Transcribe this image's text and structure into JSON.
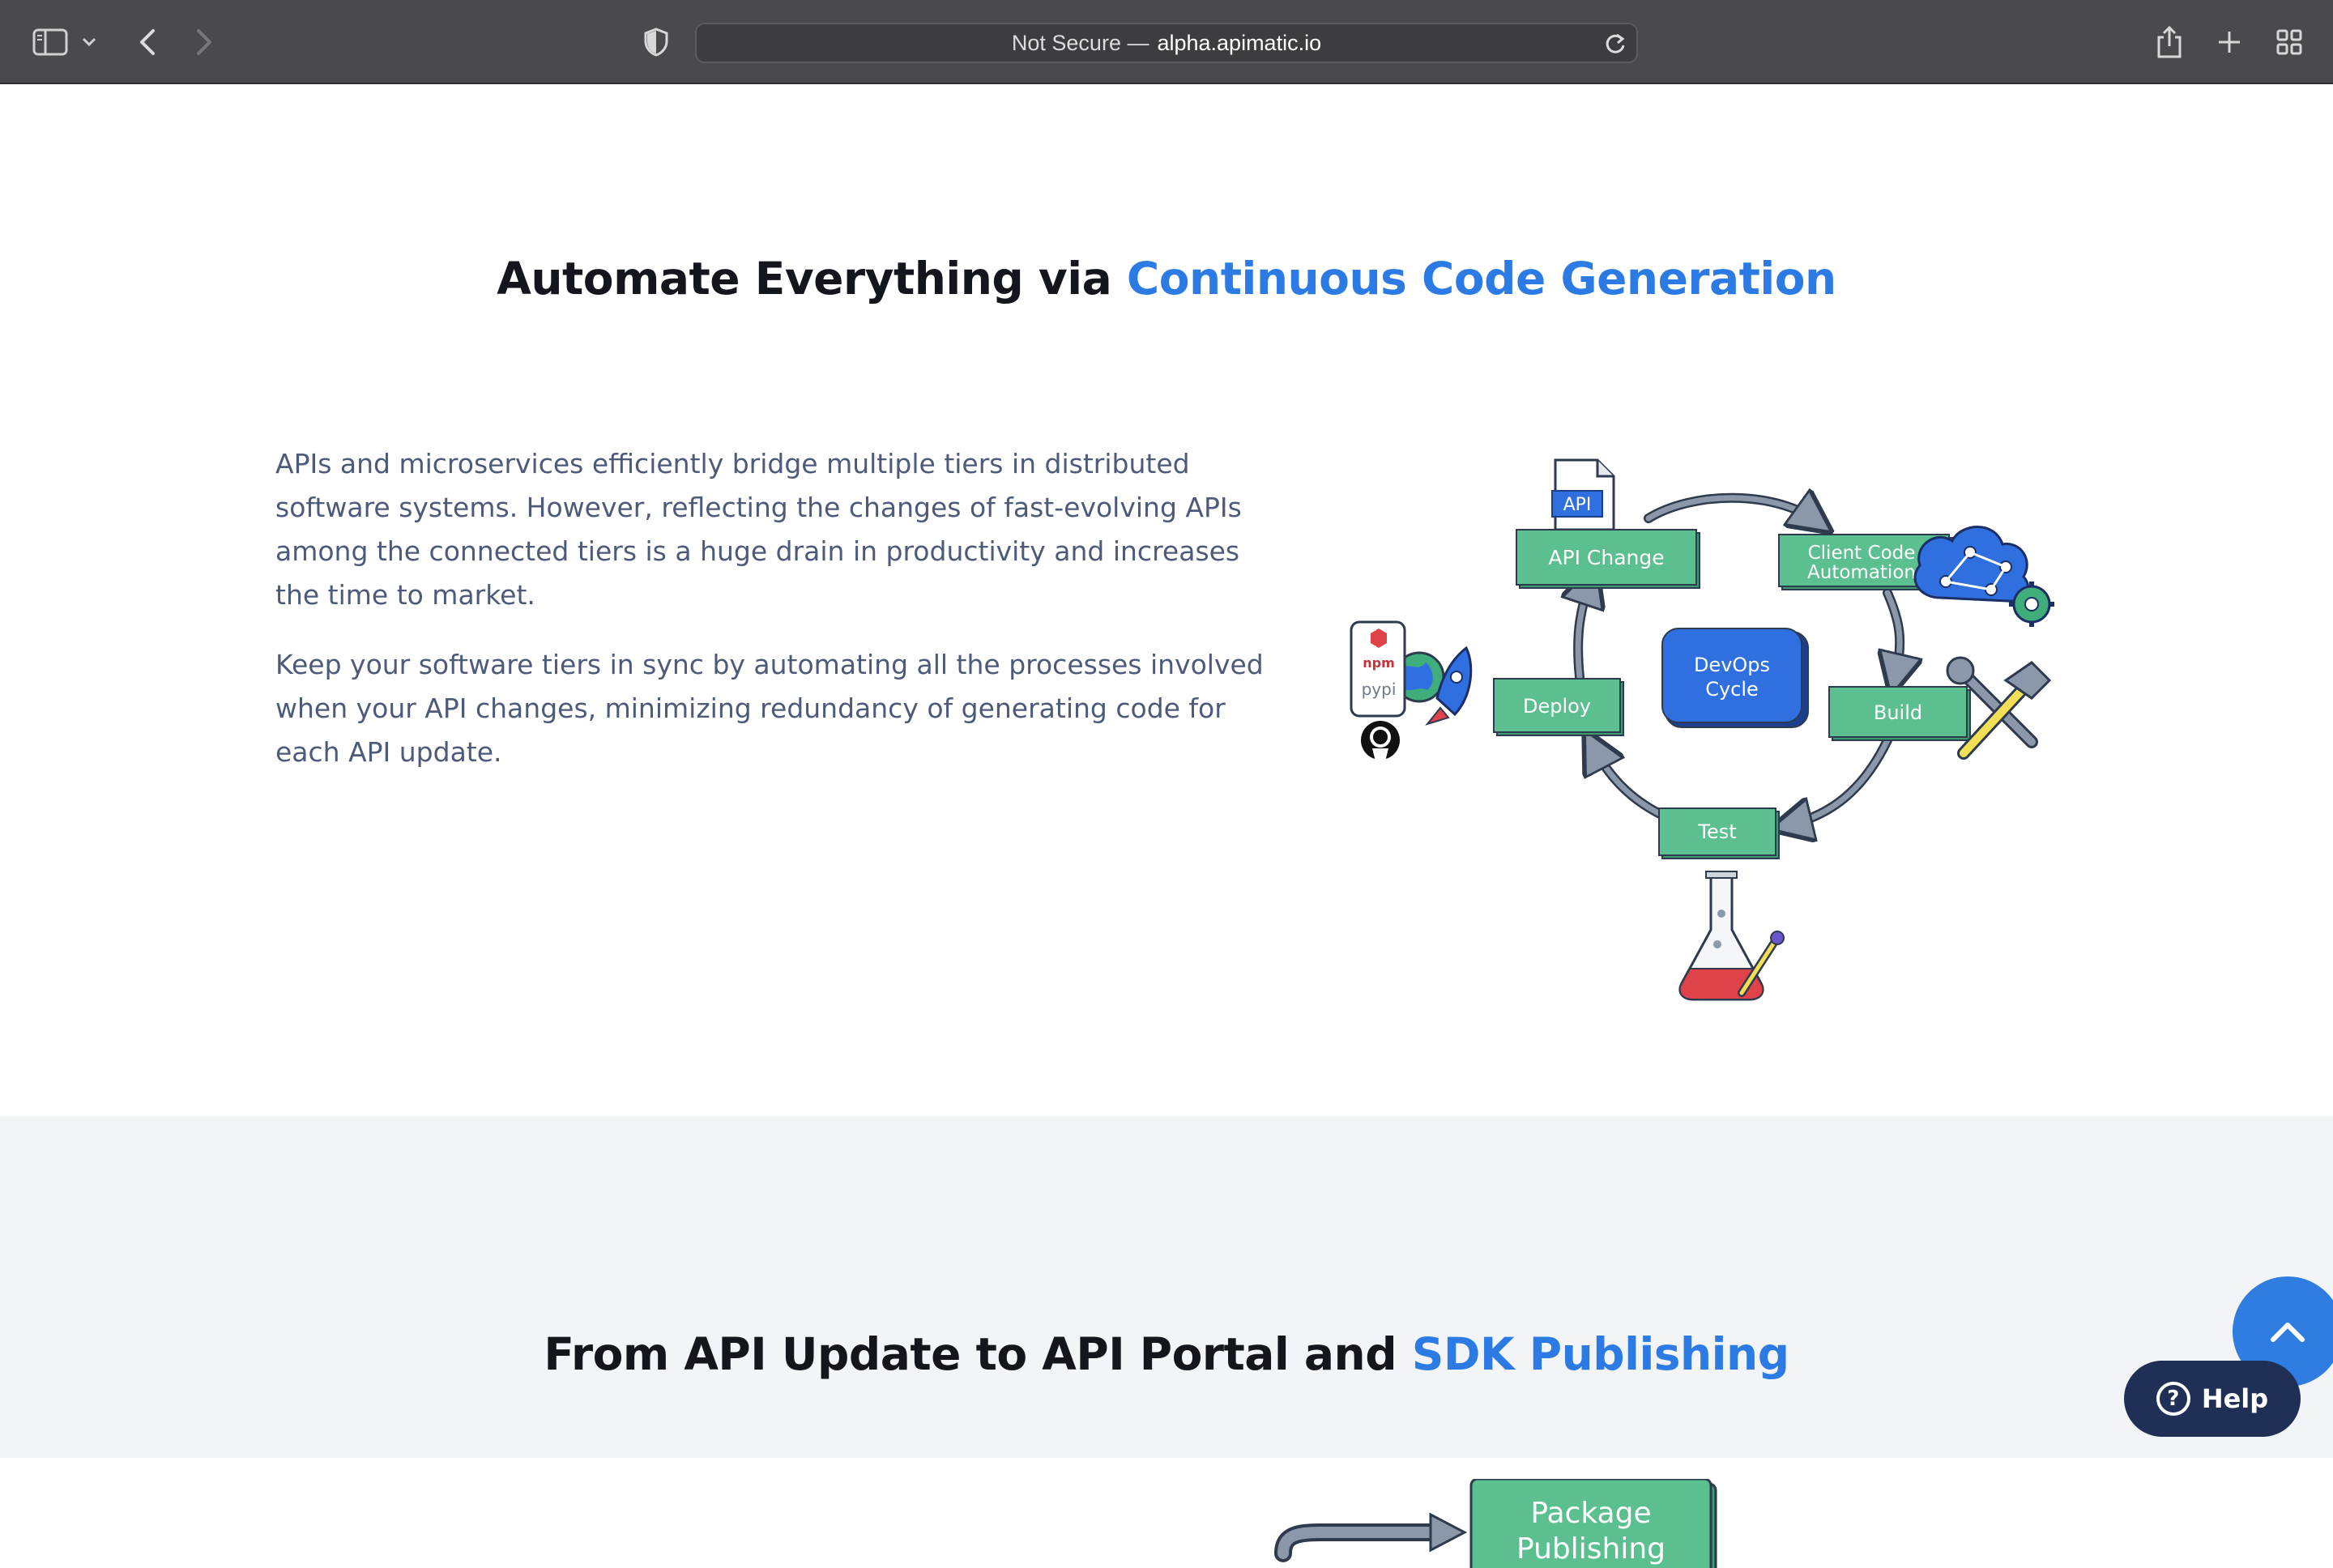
{
  "browser": {
    "url_prefix": "Not Secure —",
    "url_host": "alpha.apimatic.io"
  },
  "section_automate": {
    "title_plain": "Automate Everything via ",
    "title_accent": "Continuous Code Generation",
    "paragraph_1": "APIs and microservices efficiently bridge multiple tiers in distributed software systems. However, reflecting the changes of fast-evolving APIs among the connected tiers is a huge drain in productivity and increases the time to market.",
    "paragraph_2": "Keep your software tiers in sync by automating all the processes involved when your API changes, minimizing redundancy of generating code for each API update.",
    "diagram": {
      "center_line1": "DevOps",
      "center_line2": "Cycle",
      "api_doc_label": "API",
      "step_api_change": "API Change",
      "step_client_line1": "Client Code",
      "step_client_line2": "Automation",
      "step_build": "Build",
      "step_test": "Test",
      "step_deploy": "Deploy",
      "registry_npm": "npm",
      "registry_pypi": "pypi"
    }
  },
  "section_publish": {
    "title_plain": "From API Update to API Portal and ",
    "title_accent": "SDK Publishing",
    "card_line1": "Package",
    "card_line2": "Publishing"
  },
  "floating": {
    "help_label": "Help",
    "help_icon_glyph": "?"
  },
  "colors": {
    "accent": "#2c7be5",
    "step_green": "#5bbf8f",
    "center_blue": "#2f6fe0",
    "chrome": "#4a4a4d",
    "help_bg": "#1f2f56"
  }
}
